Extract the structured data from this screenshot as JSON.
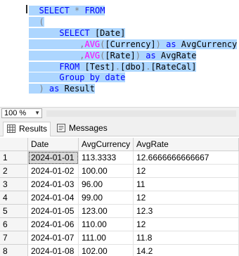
{
  "editor": {
    "lines": [
      [
        {
          "t": "  ",
          "c": "id"
        },
        {
          "t": "SELECT",
          "c": "kw"
        },
        {
          "t": " ",
          "c": "id"
        },
        {
          "t": "*",
          "c": "op"
        },
        {
          "t": " ",
          "c": "id"
        },
        {
          "t": "FROM",
          "c": "kw"
        }
      ],
      [
        {
          "t": "  ",
          "c": "id"
        },
        {
          "t": "(",
          "c": "op"
        }
      ],
      [
        {
          "t": "      ",
          "c": "id"
        },
        {
          "t": "SELECT",
          "c": "kw"
        },
        {
          "t": " ",
          "c": "id"
        },
        {
          "t": "[Date]",
          "c": "id"
        }
      ],
      [
        {
          "t": "          ",
          "c": "id"
        },
        {
          "t": ",",
          "c": "op"
        },
        {
          "t": "AVG",
          "c": "fn"
        },
        {
          "t": "(",
          "c": "op"
        },
        {
          "t": "[Currency]",
          "c": "id"
        },
        {
          "t": ")",
          "c": "op"
        },
        {
          "t": " ",
          "c": "id"
        },
        {
          "t": "as",
          "c": "kw"
        },
        {
          "t": " AvgCurrency",
          "c": "id"
        }
      ],
      [
        {
          "t": "          ",
          "c": "id"
        },
        {
          "t": ",",
          "c": "op"
        },
        {
          "t": "AVG",
          "c": "fn"
        },
        {
          "t": "(",
          "c": "op"
        },
        {
          "t": "[Rate]",
          "c": "id"
        },
        {
          "t": ")",
          "c": "op"
        },
        {
          "t": " ",
          "c": "id"
        },
        {
          "t": "as",
          "c": "kw"
        },
        {
          "t": " AvgRate",
          "c": "id"
        }
      ],
      [
        {
          "t": "      ",
          "c": "id"
        },
        {
          "t": "FROM",
          "c": "kw"
        },
        {
          "t": " ",
          "c": "id"
        },
        {
          "t": "[Test]",
          "c": "id"
        },
        {
          "t": ".",
          "c": "op"
        },
        {
          "t": "[dbo]",
          "c": "id"
        },
        {
          "t": ".",
          "c": "op"
        },
        {
          "t": "[RateCal]",
          "c": "id"
        }
      ],
      [
        {
          "t": "      ",
          "c": "id"
        },
        {
          "t": "Group by",
          "c": "kw"
        },
        {
          "t": " ",
          "c": "id"
        },
        {
          "t": "date",
          "c": "kw"
        }
      ],
      [
        {
          "t": "  ",
          "c": "id"
        },
        {
          "t": ")",
          "c": "op"
        },
        {
          "t": " ",
          "c": "id"
        },
        {
          "t": "as",
          "c": "kw"
        },
        {
          "t": " Result",
          "c": "id"
        }
      ]
    ]
  },
  "zoom": {
    "value": "100 %"
  },
  "tabs": [
    {
      "label": "Results",
      "icon": "results-grid-icon",
      "active": true
    },
    {
      "label": "Messages",
      "icon": "messages-icon",
      "active": false
    }
  ],
  "grid": {
    "columns": [
      "Date",
      "AvgCurrency",
      "AvgRate"
    ],
    "rows": [
      {
        "n": "1",
        "cells": [
          "2024-01-01",
          "113.3333",
          "12.6666666666667"
        ]
      },
      {
        "n": "2",
        "cells": [
          "2024-01-02",
          "100.00",
          "12"
        ]
      },
      {
        "n": "3",
        "cells": [
          "2024-01-03",
          "96.00",
          "11"
        ]
      },
      {
        "n": "4",
        "cells": [
          "2024-01-04",
          "99.00",
          "12"
        ]
      },
      {
        "n": "5",
        "cells": [
          "2024-01-05",
          "123.00",
          "12.3"
        ]
      },
      {
        "n": "6",
        "cells": [
          "2024-01-06",
          "110.00",
          "12"
        ]
      },
      {
        "n": "7",
        "cells": [
          "2024-01-07",
          "111.00",
          "11.8"
        ]
      },
      {
        "n": "8",
        "cells": [
          "2024-01-08",
          "102.00",
          "14.2"
        ]
      }
    ]
  },
  "colors": {
    "selection": "#add6ff",
    "keyword": "#0000ff",
    "function": "#ff00ff",
    "operator": "#808080"
  }
}
